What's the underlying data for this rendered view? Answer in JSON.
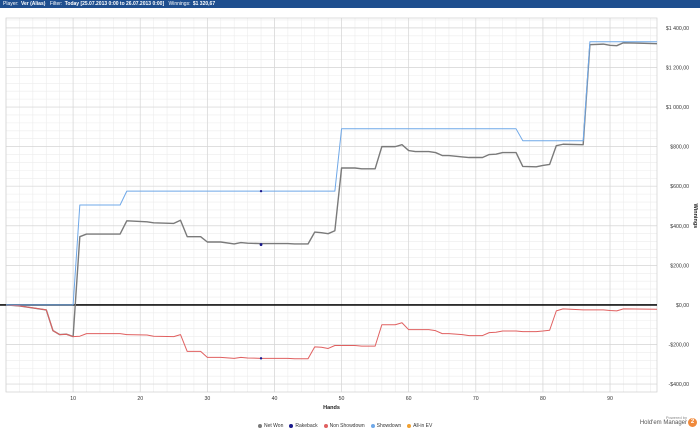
{
  "header": {
    "player_label": "Player:",
    "player_value": "Ver (Alias)",
    "filter_label": "Filter:",
    "filter_value": "Today [25.07.2013 0:00 to 26.07.2013 0:00]",
    "winnings_label": "Winnings:",
    "winnings_value": "$1 320,67"
  },
  "brand": {
    "powered": "Powered by",
    "name": "Hold'em Manager",
    "logo": "2"
  },
  "chart_data": {
    "type": "line",
    "xlabel": "Hands",
    "ylabel": "Winnings",
    "xlim": [
      0,
      97
    ],
    "ylim": [
      -440,
      1450
    ],
    "x_ticks": [
      10,
      20,
      30,
      40,
      50,
      60,
      70,
      80,
      90
    ],
    "y_ticks": [
      -400,
      -200,
      0,
      200,
      400,
      600,
      800,
      1000,
      1200,
      1400
    ],
    "y_tick_labels": [
      "-$400,00",
      "-$200,00",
      "$0,00",
      "$200,00",
      "$400,00",
      "$600,00",
      "$800,00",
      "$1 000,00",
      "$1 200,00",
      "$1 400,00"
    ],
    "grid": true,
    "legend_position": "bottom",
    "series": [
      {
        "name": "Net Won",
        "color": "#7a7a7a",
        "points": [
          [
            0,
            0
          ],
          [
            2,
            -5
          ],
          [
            6,
            -25
          ],
          [
            7,
            -130
          ],
          [
            8,
            -150
          ],
          [
            9,
            -148
          ],
          [
            10,
            -160
          ],
          [
            11,
            345
          ],
          [
            12,
            358
          ],
          [
            17,
            358
          ],
          [
            18,
            425
          ],
          [
            21,
            420
          ],
          [
            22,
            415
          ],
          [
            25,
            412
          ],
          [
            26,
            428
          ],
          [
            27,
            345
          ],
          [
            29,
            345
          ],
          [
            30,
            318
          ],
          [
            32,
            318
          ],
          [
            34,
            308
          ],
          [
            35,
            315
          ],
          [
            36,
            312
          ],
          [
            38,
            310
          ],
          [
            42,
            310
          ],
          [
            43,
            308
          ],
          [
            45,
            308
          ],
          [
            46,
            368
          ],
          [
            47,
            365
          ],
          [
            48,
            360
          ],
          [
            49,
            375
          ],
          [
            50,
            692
          ],
          [
            52,
            692
          ],
          [
            53,
            688
          ],
          [
            55,
            688
          ],
          [
            56,
            800
          ],
          [
            58,
            800
          ],
          [
            59,
            810
          ],
          [
            60,
            780
          ],
          [
            61,
            775
          ],
          [
            63,
            775
          ],
          [
            64,
            770
          ],
          [
            65,
            755
          ],
          [
            66,
            755
          ],
          [
            68,
            748
          ],
          [
            69,
            745
          ],
          [
            71,
            745
          ],
          [
            72,
            760
          ],
          [
            73,
            762
          ],
          [
            74,
            770
          ],
          [
            76,
            770
          ],
          [
            77,
            700
          ],
          [
            79,
            698
          ],
          [
            80,
            705
          ],
          [
            81,
            710
          ],
          [
            82,
            805
          ],
          [
            83,
            812
          ],
          [
            86,
            810
          ],
          [
            87,
            1315
          ],
          [
            89,
            1318
          ],
          [
            90,
            1312
          ],
          [
            91,
            1310
          ],
          [
            92,
            1325
          ],
          [
            97,
            1320
          ]
        ]
      },
      {
        "name": "Rakeback",
        "color": "#1a1a8c",
        "points": [
          [
            38,
            305
          ]
        ]
      },
      {
        "name": "Non Showdown",
        "color": "#e06060",
        "points": [
          [
            0,
            0
          ],
          [
            2,
            -5
          ],
          [
            6,
            -25
          ],
          [
            7,
            -130
          ],
          [
            8,
            -150
          ],
          [
            9,
            -148
          ],
          [
            10,
            -160
          ],
          [
            11,
            -158
          ],
          [
            12,
            -145
          ],
          [
            17,
            -145
          ],
          [
            18,
            -150
          ],
          [
            21,
            -152
          ],
          [
            22,
            -158
          ],
          [
            25,
            -160
          ],
          [
            26,
            -150
          ],
          [
            27,
            -235
          ],
          [
            29,
            -235
          ],
          [
            30,
            -265
          ],
          [
            32,
            -265
          ],
          [
            34,
            -270
          ],
          [
            35,
            -265
          ],
          [
            36,
            -268
          ],
          [
            38,
            -270
          ],
          [
            42,
            -270
          ],
          [
            43,
            -272
          ],
          [
            45,
            -272
          ],
          [
            46,
            -212
          ],
          [
            47,
            -214
          ],
          [
            48,
            -220
          ],
          [
            49,
            -205
          ],
          [
            52,
            -205
          ],
          [
            53,
            -208
          ],
          [
            55,
            -208
          ],
          [
            56,
            -100
          ],
          [
            58,
            -100
          ],
          [
            59,
            -90
          ],
          [
            60,
            -125
          ],
          [
            63,
            -125
          ],
          [
            64,
            -130
          ],
          [
            65,
            -145
          ],
          [
            66,
            -145
          ],
          [
            68,
            -150
          ],
          [
            69,
            -155
          ],
          [
            71,
            -155
          ],
          [
            72,
            -140
          ],
          [
            73,
            -138
          ],
          [
            74,
            -132
          ],
          [
            76,
            -132
          ],
          [
            77,
            -135
          ],
          [
            79,
            -135
          ],
          [
            80,
            -132
          ],
          [
            81,
            -128
          ],
          [
            82,
            -30
          ],
          [
            83,
            -20
          ],
          [
            86,
            -25
          ],
          [
            89,
            -25
          ],
          [
            90,
            -28
          ],
          [
            91,
            -30
          ],
          [
            92,
            -20
          ],
          [
            97,
            -22
          ]
        ]
      },
      {
        "name": "Showdown",
        "color": "#6fa8e8",
        "points": [
          [
            0,
            0
          ],
          [
            10,
            0
          ],
          [
            11,
            505
          ],
          [
            17,
            505
          ],
          [
            18,
            575
          ],
          [
            49,
            575
          ],
          [
            50,
            890
          ],
          [
            76,
            890
          ],
          [
            77,
            830
          ],
          [
            86,
            830
          ],
          [
            87,
            1330
          ],
          [
            97,
            1330
          ]
        ]
      },
      {
        "name": "All-in EV",
        "color": "#f0a030",
        "points": []
      }
    ]
  }
}
